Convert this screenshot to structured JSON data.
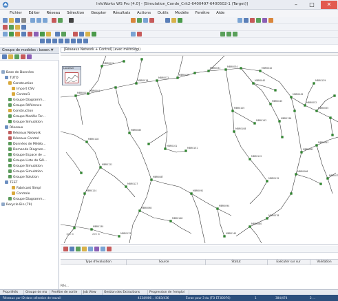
{
  "window": {
    "title": "InfoWorks WS Pro [4.0] - [Simulation_Conde_Crit2-6400497-6400502-1 (Target)]",
    "minimize_glyph": "–",
    "maximize_glyph": "□",
    "close_glyph": "✕"
  },
  "menu": [
    "Fichier",
    "Editer",
    "Réseau",
    "Sélection",
    "Geopter",
    "Résultats",
    "Actions",
    "Outils",
    "Modèle",
    "Fenêtre",
    "Aide"
  ],
  "left_panel": {
    "tab_label": "Groupe de modèles : base...",
    "tab_icons": "✕ ▼",
    "tree": [
      {
        "label": "Base de Données",
        "level": 0,
        "color": "#8fa8c8"
      },
      {
        "label": "TUTO",
        "level": 1,
        "color": "#6c8fc1"
      },
      {
        "label": "Construction",
        "level": 2,
        "color": "#d9a93c"
      },
      {
        "label": "Import CSV",
        "level": 3,
        "color": "#d9a93c"
      },
      {
        "label": "Control1",
        "level": 3,
        "color": "#d9a93c"
      },
      {
        "label": "Groupe Diagramm...",
        "level": 2,
        "color": "#5c9b5c"
      },
      {
        "label": "Groupe Référence",
        "level": 2,
        "color": "#5c9b5c"
      },
      {
        "label": "Construction",
        "level": 2,
        "color": "#d9a93c"
      },
      {
        "label": "Groupe Modèle Ter...",
        "level": 2,
        "color": "#5c9b5c"
      },
      {
        "label": "Groupe Simulation",
        "level": 2,
        "color": "#5c9b5c"
      },
      {
        "label": "Réseaux",
        "level": 1,
        "color": "#6c8fc1"
      },
      {
        "label": "Réseaux Network",
        "level": 2,
        "color": "#c06060"
      },
      {
        "label": "Réseaux Control",
        "level": 2,
        "color": "#c06060"
      },
      {
        "label": "Données de Météo...",
        "level": 2,
        "color": "#5c9b5c"
      },
      {
        "label": "Demande Diagram...",
        "level": 2,
        "color": "#5c9b5c"
      },
      {
        "label": "Groupe Espace de ...",
        "level": 2,
        "color": "#5c9b5c"
      },
      {
        "label": "Groupe Liste de Sél...",
        "level": 2,
        "color": "#5c9b5c"
      },
      {
        "label": "Groupe Simulation",
        "level": 2,
        "color": "#5c9b5c"
      },
      {
        "label": "Groupe Simulation",
        "level": 2,
        "color": "#5c9b5c"
      },
      {
        "label": "Groupe Solution",
        "level": 2,
        "color": "#5c9b5c"
      },
      {
        "label": "TEST",
        "level": 1,
        "color": "#6c8fc1"
      },
      {
        "label": "Fabricant Simpl",
        "level": 3,
        "color": "#d9a93c"
      },
      {
        "label": "Controle",
        "level": 3,
        "color": "#d9a93c"
      },
      {
        "label": "Groupe Diagramm...",
        "level": 2,
        "color": "#5c9b5c"
      },
      {
        "label": "Recycle Bin (79)",
        "level": 0,
        "color": "#8fa8c8"
      }
    ]
  },
  "document": {
    "tab_label": "[Réseaux Network + Control] (avec métrologi)",
    "overview_label": "Localiser",
    "scale_a": "100 m",
    "scale_b": "200 m"
  },
  "bottom_panel": {
    "columns": [
      "Type d'évaluation",
      "Source",
      "Statut",
      "Exécuter sur sur",
      "Validation"
    ],
    "row_label": "Rés..."
  },
  "bottom_tabs": [
    "Propriétés",
    "Groupe de mo",
    "Fenêtre de sortie",
    "Job View",
    "Gestion des Extractions",
    "Progression de l'emploi"
  ],
  "status": [
    "Réseaux par ID dans sélection de travail",
    "4534/006 .. 0383/436",
    "Écran pour 3 du (TO ET.00076)",
    "1",
    "384/474",
    "2 ... "
  ]
}
